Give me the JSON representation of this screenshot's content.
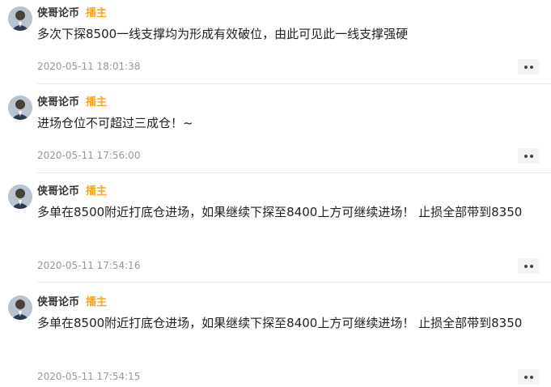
{
  "posts": [
    {
      "author": "侠哥论币",
      "badge": "播主",
      "content": "多次下探8500一线支撑均为形成有效破位，由此可见此一线支撑强硬",
      "timestamp": "2020-05-11 18:01:38"
    },
    {
      "author": "侠哥论币",
      "badge": "播主",
      "content": "进场仓位不可超过三成仓！~",
      "timestamp": "2020-05-11 17:56:00"
    },
    {
      "author": "侠哥论币",
      "badge": "播主",
      "content": "多单在8500附近打底仓进场，如果继续下探至8400上方可继续进场！ 止损全部带到8350",
      "timestamp": "2020-05-11 17:54:16"
    },
    {
      "author": "侠哥论币",
      "badge": "播主",
      "content": "多单在8500附近打底仓进场，如果继续下探至8400上方可继续进场！ 止损全部带到8350",
      "timestamp": "2020-05-11 17:54:15"
    }
  ],
  "icons": {
    "more": "more-dots-icon",
    "avatar": "avatar-portrait"
  },
  "colors": {
    "badge": "#f5a623",
    "timestamp": "#999999",
    "button_bg": "#f3f3f3"
  }
}
